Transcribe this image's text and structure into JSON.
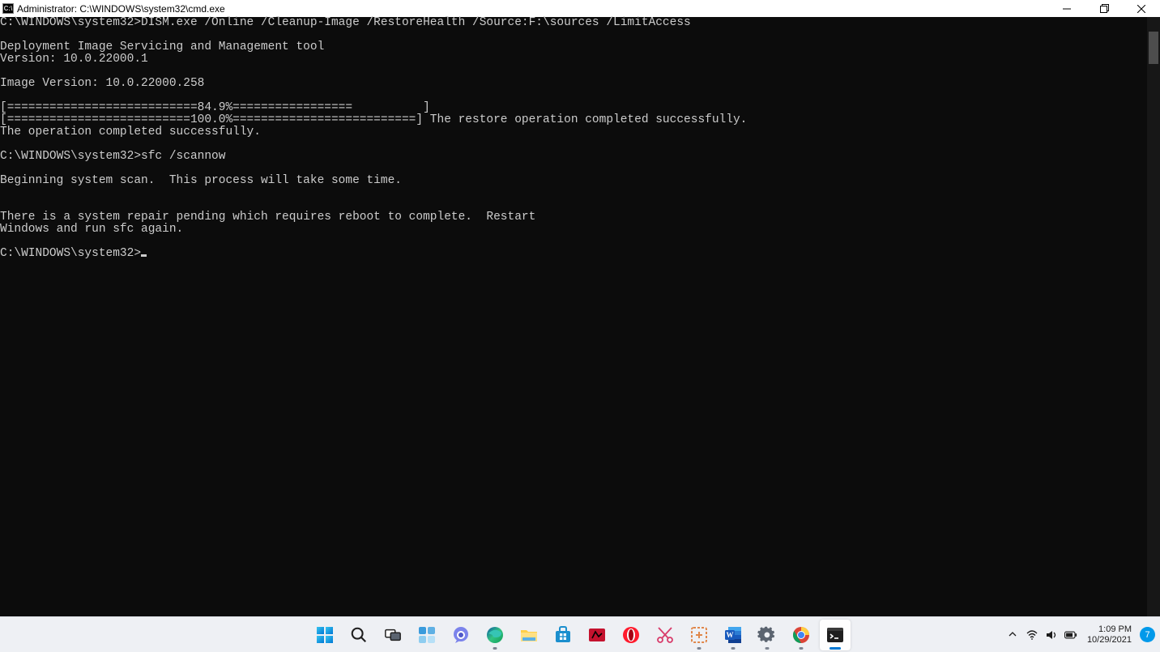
{
  "window": {
    "icon_label": "cmd",
    "title": "Administrator: C:\\WINDOWS\\system32\\cmd.exe"
  },
  "terminal": {
    "lines": [
      "C:\\WINDOWS\\system32>DISM.exe /Online /Cleanup-Image /RestoreHealth /Source:F:\\sources /LimitAccess",
      "",
      "Deployment Image Servicing and Management tool",
      "Version: 10.0.22000.1",
      "",
      "Image Version: 10.0.22000.258",
      "",
      "[===========================84.9%=================          ]",
      "[==========================100.0%==========================] The restore operation completed successfully.",
      "The operation completed successfully.",
      "",
      "C:\\WINDOWS\\system32>sfc /scannow",
      "",
      "Beginning system scan.  This process will take some time.",
      "",
      "",
      "There is a system repair pending which requires reboot to complete.  Restart",
      "Windows and run sfc again.",
      "",
      "C:\\WINDOWS\\system32>"
    ]
  },
  "taskbar": {
    "items": [
      {
        "name": "start",
        "label": "Start"
      },
      {
        "name": "search",
        "label": "Search"
      },
      {
        "name": "task-view",
        "label": "Task View"
      },
      {
        "name": "widgets",
        "label": "Widgets"
      },
      {
        "name": "teams-chat",
        "label": "Chat"
      },
      {
        "name": "edge",
        "label": "Microsoft Edge"
      },
      {
        "name": "file-explorer",
        "label": "File Explorer"
      },
      {
        "name": "microsoft-store",
        "label": "Microsoft Store"
      },
      {
        "name": "app-red",
        "label": "App"
      },
      {
        "name": "opera",
        "label": "Opera"
      },
      {
        "name": "snip-sketch",
        "label": "Snip & Sketch"
      },
      {
        "name": "snipping-tool",
        "label": "Snipping Tool"
      },
      {
        "name": "word",
        "label": "Word"
      },
      {
        "name": "settings",
        "label": "Settings"
      },
      {
        "name": "chrome",
        "label": "Google Chrome"
      },
      {
        "name": "command-prompt",
        "label": "Command Prompt",
        "active": true
      }
    ]
  },
  "tray": {
    "time": "1:09 PM",
    "date": "10/29/2021",
    "notification_count": "7"
  }
}
